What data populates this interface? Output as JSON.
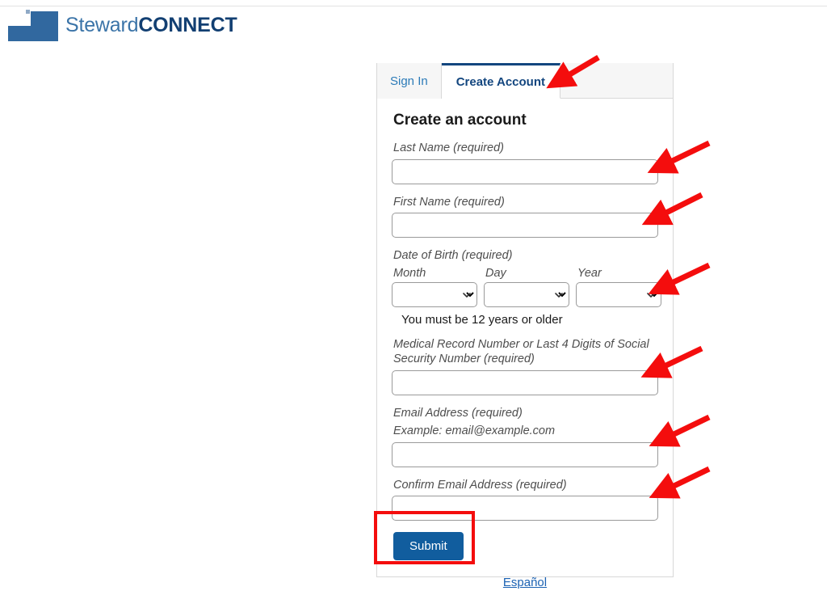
{
  "brand": {
    "name_light": "Steward",
    "name_bold": "CONNECT",
    "mark_color": "#31689f",
    "light_color": "#3b74a8",
    "bold_color": "#123f72"
  },
  "tabs": [
    {
      "label": "Sign In",
      "active": false
    },
    {
      "label": "Create Account",
      "active": true
    }
  ],
  "form": {
    "title": "Create an account",
    "fields": {
      "last_name": {
        "label": "Last Name (required)",
        "value": "",
        "placeholder": ""
      },
      "first_name": {
        "label": "First Name (required)",
        "value": "",
        "placeholder": ""
      },
      "dob": {
        "label": "Date of Birth (required)",
        "month_label": "Month",
        "day_label": "Day",
        "year_label": "Year",
        "month_value": "",
        "day_value": "",
        "year_value": "",
        "help": "You must be 12 years or older"
      },
      "mrn": {
        "label": "Medical Record Number or Last 4 Digits of Social Security Number (required)",
        "value": "",
        "placeholder": ""
      },
      "email": {
        "label": "Email Address (required)",
        "example": "Example: email@example.com",
        "value": "",
        "placeholder": ""
      },
      "confirm_email": {
        "label": "Confirm Email Address (required)",
        "value": "",
        "placeholder": ""
      }
    },
    "submit_label": "Submit"
  },
  "footer": {
    "language_link": "Español"
  },
  "annotations": {
    "arrow_color": "#f40d0d",
    "highlight_color": "#f40d0d",
    "arrow_count": 7,
    "highlight_target": "Submit"
  }
}
